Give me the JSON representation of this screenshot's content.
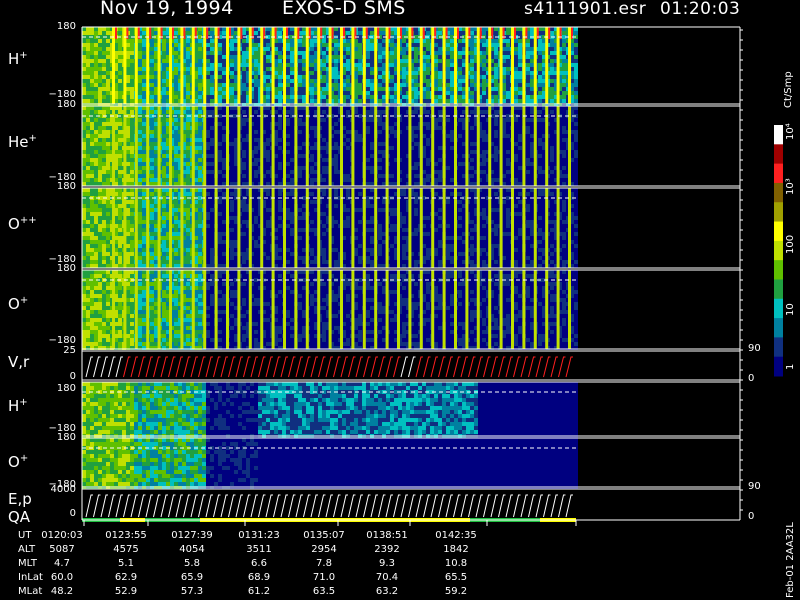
{
  "header": {
    "date": "Nov 19, 1994",
    "instrument": "EXOS-D SMS",
    "file": "s4111901.esr",
    "time": "01:20:03"
  },
  "panels": [
    {
      "label": "H",
      "sup": "+",
      "ytop": "180",
      "ybot": "−180"
    },
    {
      "label": "He",
      "sup": "+",
      "ytop": "180",
      "ybot": "−180"
    },
    {
      "label": "O",
      "sup": "++",
      "ytop": "180",
      "ybot": "−180"
    },
    {
      "label": "O",
      "sup": "+",
      "ytop": "180",
      "ybot": "−180"
    },
    {
      "label": "V,r",
      "sup": "",
      "ytop": "25",
      "ybot": "0",
      "rtop": "90",
      "rbot": "0"
    },
    {
      "label": "H",
      "sup": "+",
      "ytop": "180",
      "ybot": "−180"
    },
    {
      "label": "O",
      "sup": "+",
      "ytop": "180",
      "ybot": "−180"
    },
    {
      "label": "E,p",
      "label2": "QA",
      "sup": "",
      "ytop": "4000",
      "ybot": "0",
      "rtop": "90",
      "rbot": "0"
    }
  ],
  "colorbar": {
    "unit": "Ct/Smp",
    "ticks": [
      "10⁴",
      "10³",
      "100",
      "10",
      "1"
    ],
    "colors": [
      "#ffffff",
      "#a00000",
      "#ff2020",
      "#806000",
      "#a0a000",
      "#ffff00",
      "#c0e000",
      "#60c000",
      "#20a040",
      "#00c0c0",
      "#0080a0",
      "#103080",
      "#000080"
    ]
  },
  "table": {
    "rows": [
      {
        "name": "UT",
        "values": [
          "0120:03",
          "0123:55",
          "0127:39",
          "0131:23",
          "0135:07",
          "0138:51",
          "0142:35"
        ]
      },
      {
        "name": "ALT",
        "values": [
          "5087",
          "4575",
          "4054",
          "3511",
          "2954",
          "2392",
          "1842"
        ]
      },
      {
        "name": "MLT",
        "values": [
          "4.7",
          "5.1",
          "5.8",
          "6.6",
          "7.8",
          "9.3",
          "10.8"
        ]
      },
      {
        "name": "InLat",
        "values": [
          "60.0",
          "62.9",
          "65.9",
          "68.9",
          "71.0",
          "70.4",
          "65.5"
        ]
      },
      {
        "name": "MLat",
        "values": [
          "48.2",
          "52.9",
          "57.3",
          "61.2",
          "63.5",
          "63.2",
          "59.2"
        ]
      }
    ]
  },
  "footer_vertical": "Feb-01 2AA32L",
  "chart_data": {
    "type": "heatmap",
    "title": "Nov 19, 1994 EXOS-D SMS",
    "x": [
      "0120:03",
      "0123:55",
      "0127:39",
      "0131:23",
      "0135:07",
      "0138:51",
      "0142:35"
    ],
    "ylim_angle": [
      -180,
      180
    ],
    "colorbar_unit": "Ct/Smp",
    "colorbar_range": [
      1,
      10000
    ],
    "colorbar_scale": "log",
    "series": [
      {
        "name": "H+"
      },
      {
        "name": "He+"
      },
      {
        "name": "O++"
      },
      {
        "name": "O+"
      },
      {
        "name": "V,r",
        "ylim": [
          0,
          25
        ],
        "ylim_right": [
          0,
          90
        ]
      },
      {
        "name": "H+"
      },
      {
        "name": "O+"
      },
      {
        "name": "E,p",
        "ylim": [
          0,
          4000
        ],
        "ylim_right": [
          0,
          90
        ]
      }
    ]
  }
}
